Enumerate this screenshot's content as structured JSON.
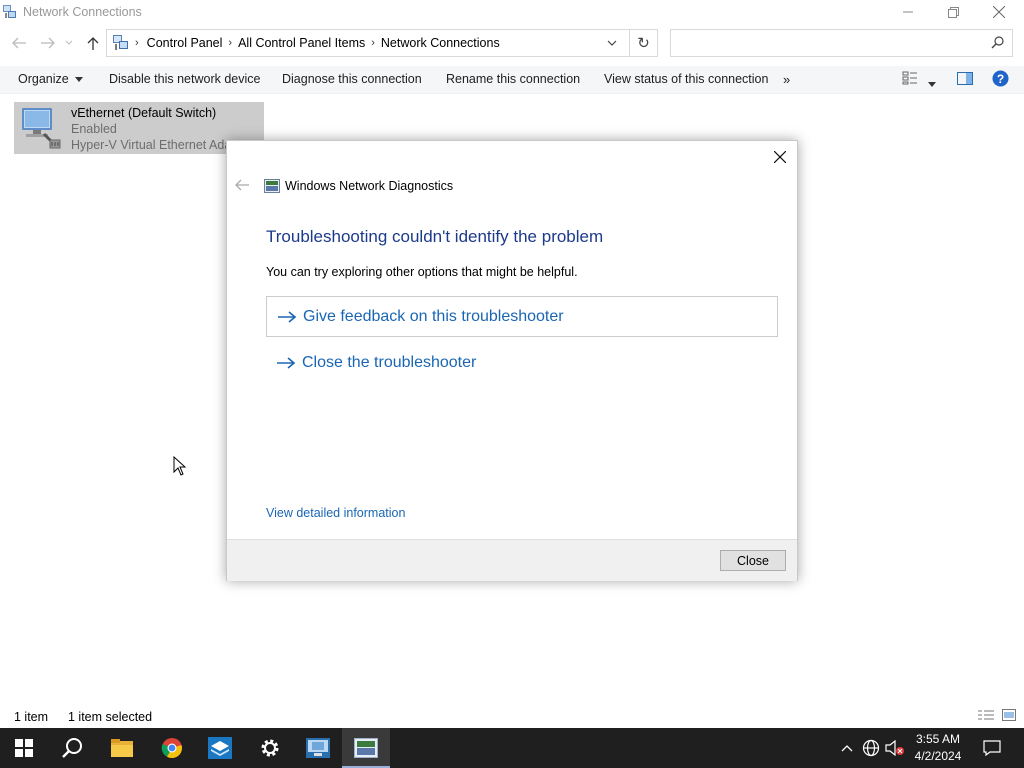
{
  "window": {
    "title": "Network Connections"
  },
  "address": {
    "crumbs": [
      "Control Panel",
      "All Control Panel Items",
      "Network Connections"
    ],
    "search_placeholder": ""
  },
  "commands": {
    "organize": "Organize",
    "disable": "Disable this network device",
    "diagnose": "Diagnose this connection",
    "rename": "Rename this connection",
    "view_status": "View status of this connection",
    "more": "»"
  },
  "adapter": {
    "name": "vEthernet (Default Switch)",
    "status": "Enabled",
    "device": "Hyper-V Virtual Ethernet Adapter"
  },
  "statusbar": {
    "count": "1 item",
    "selected": "1 item selected"
  },
  "dialog": {
    "title": "Windows Network Diagnostics",
    "heading": "Troubleshooting couldn't identify the problem",
    "subtext": "You can try exploring other options that might be helpful.",
    "option1": "Give feedback on this troubleshooter",
    "option2": "Close the troubleshooter",
    "details_link": "View detailed information",
    "close_button": "Close"
  },
  "taskbar": {
    "time": "3:55 AM",
    "date": "4/2/2024"
  },
  "colors": {
    "link": "#1a66b3",
    "heading": "#1c3a8a",
    "taskbar": "#1f1f1f",
    "selection": "#cccccc"
  }
}
